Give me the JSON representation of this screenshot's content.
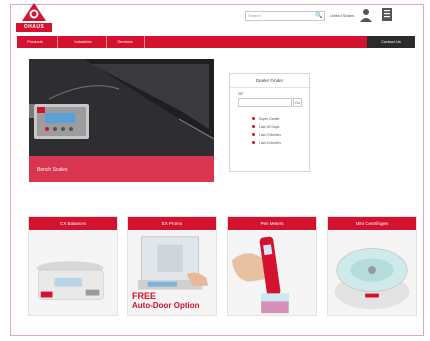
{
  "brand": {
    "logo_text": "OHAUS",
    "accent": "#d4112e"
  },
  "header": {
    "search_placeholder": "Search",
    "search_button": "🔍",
    "country": "United States",
    "icons": [
      "user-icon",
      "cart-icon"
    ]
  },
  "nav": {
    "items": [
      "Products",
      "Industries",
      "Services"
    ],
    "contact": "Contact Us"
  },
  "hero": {
    "caption": "Bench Scales"
  },
  "dealer": {
    "title": "Dealer Finder",
    "zip_label": "ZIP",
    "go_label": "Go",
    "links": [
      "Super Dealer",
      "Last 30 Days",
      "Last 3 Months",
      "Last 6 Months"
    ]
  },
  "tiles": [
    {
      "label": "CX Balances"
    },
    {
      "label": "EX Promo",
      "overlay_line1": "FREE",
      "overlay_line2": "Auto-Door Option"
    },
    {
      "label": "Pen Meters"
    },
    {
      "label": "Mini Centrifuges"
    }
  ]
}
